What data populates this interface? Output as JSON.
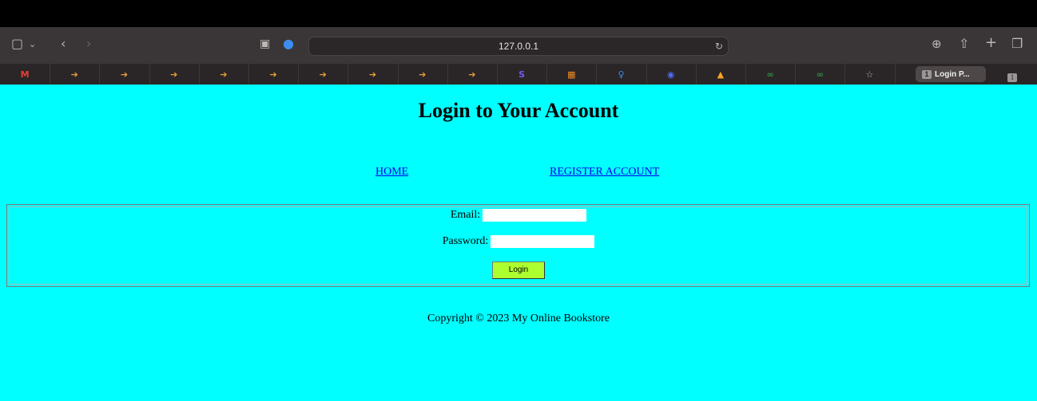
{
  "browser": {
    "address": "127.0.0.1",
    "favorites": [
      {
        "icon": "gmail-icon",
        "glyph": "M",
        "color": "#e44134"
      },
      {
        "icon": "bookmark-arrow-icon",
        "glyph": "➔",
        "color": "#e8a03a"
      },
      {
        "icon": "bookmark-arrow-icon",
        "glyph": "➔",
        "color": "#e8a03a"
      },
      {
        "icon": "bookmark-arrow-icon",
        "glyph": "➔",
        "color": "#e8a03a"
      },
      {
        "icon": "bookmark-arrow-icon",
        "glyph": "➔",
        "color": "#e8a03a"
      },
      {
        "icon": "bookmark-arrow-icon",
        "glyph": "➔",
        "color": "#e8a03a"
      },
      {
        "icon": "bookmark-arrow-icon",
        "glyph": "➔",
        "color": "#e8a03a"
      },
      {
        "icon": "bookmark-arrow-icon",
        "glyph": "➔",
        "color": "#e8a03a"
      },
      {
        "icon": "bookmark-arrow-icon",
        "glyph": "➔",
        "color": "#e8a03a"
      },
      {
        "icon": "bookmark-arrow-icon",
        "glyph": "➔",
        "color": "#e8a03a"
      },
      {
        "icon": "app-s-icon",
        "glyph": "S",
        "color": "#6f5cf2"
      },
      {
        "icon": "app-grid-icon",
        "glyph": "▦",
        "color": "#f08a24"
      },
      {
        "icon": "bulb-icon",
        "glyph": "♀",
        "color": "#3d8df0"
      },
      {
        "icon": "code-icon",
        "glyph": "◉",
        "color": "#4d6df5"
      },
      {
        "icon": "firebase-icon",
        "glyph": "▲",
        "color": "#f5a623"
      },
      {
        "icon": "geeks-icon",
        "glyph": "∞",
        "color": "#2f8d46"
      },
      {
        "icon": "geeks-icon",
        "glyph": "∞",
        "color": "#2f8d46"
      },
      {
        "icon": "star-icon",
        "glyph": "☆",
        "color": "#bdb8b8"
      }
    ],
    "active_tab": {
      "badge": "1",
      "label": "Login P..."
    },
    "second_tab": {
      "badge": "1"
    }
  },
  "page": {
    "title": "Login to Your Account",
    "nav": {
      "home": "HOME",
      "register": "REGISTER ACCOUNT"
    },
    "form": {
      "email_label": "Email:",
      "password_label": "Password:",
      "submit": "Login"
    },
    "footer": "Copyright © 2023 My Online Bookstore"
  },
  "colors": {
    "page_bg": "#00ffff",
    "button_bg": "#adff2f",
    "link": "#0000ee"
  }
}
